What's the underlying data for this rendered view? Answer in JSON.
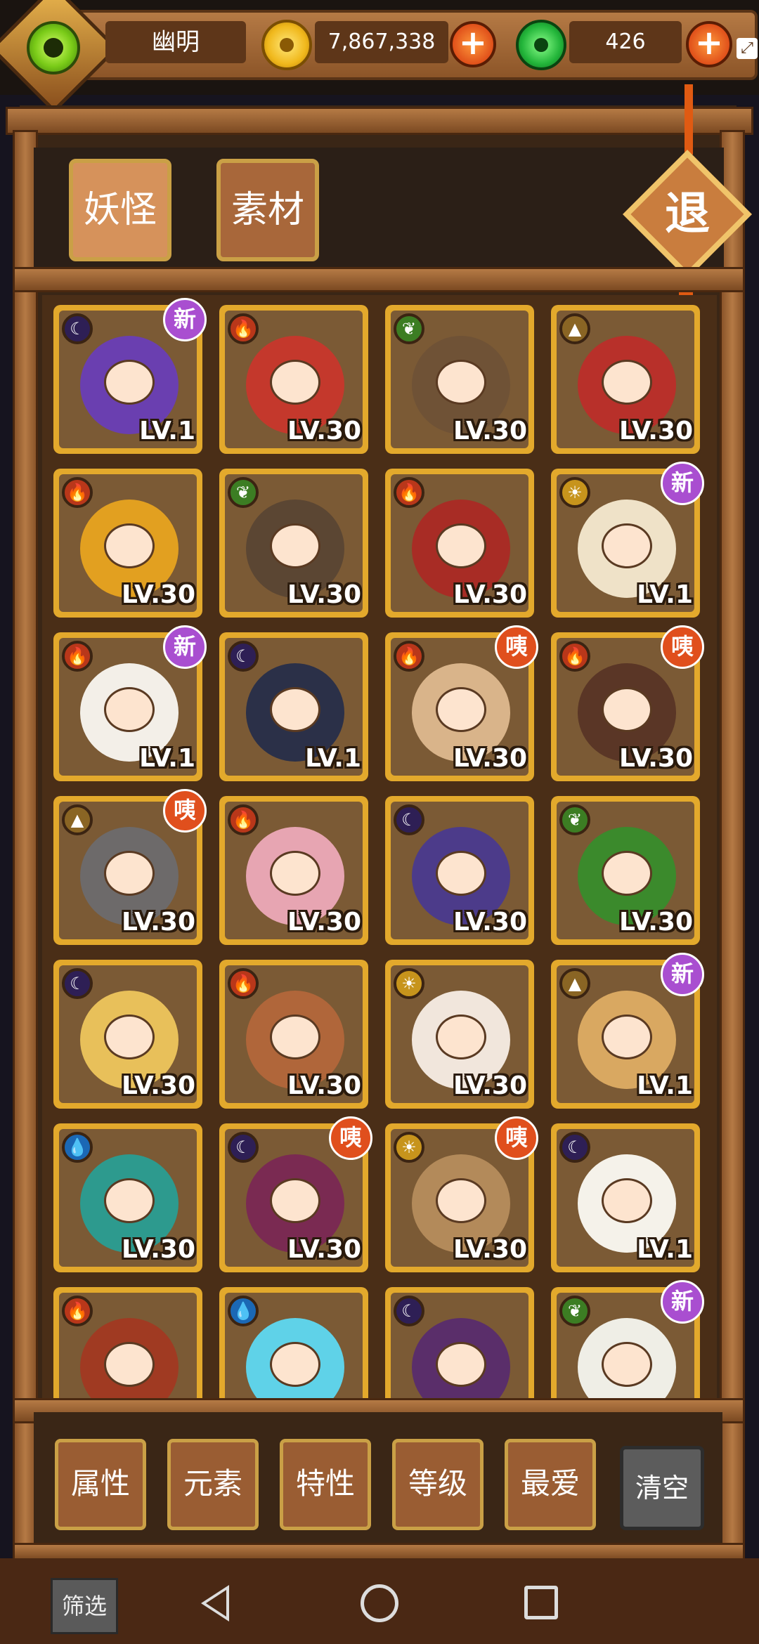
{
  "player": {
    "name": "幽明"
  },
  "currency": {
    "gold": "7,867,338",
    "jade": "426"
  },
  "tabs": [
    "妖怪",
    "素材"
  ],
  "exit_label": "退",
  "cards": [
    {
      "elem": "moon",
      "elem_icon": "☾",
      "level": "LV.1",
      "badge": "新",
      "badge_type": "new",
      "color": "#6a3fb0"
    },
    {
      "elem": "fire",
      "elem_icon": "🔥",
      "level": "LV.30",
      "badge": "",
      "badge_type": "",
      "color": "#c4382c"
    },
    {
      "elem": "leaf",
      "elem_icon": "❦",
      "level": "LV.30",
      "badge": "",
      "badge_type": "",
      "color": "#6f5236"
    },
    {
      "elem": "earth",
      "elem_icon": "▲",
      "level": "LV.30",
      "badge": "",
      "badge_type": "",
      "color": "#b8302a"
    },
    {
      "elem": "fire",
      "elem_icon": "🔥",
      "level": "LV.30",
      "badge": "",
      "badge_type": "",
      "color": "#e2a020"
    },
    {
      "elem": "leaf",
      "elem_icon": "❦",
      "level": "LV.30",
      "badge": "",
      "badge_type": "",
      "color": "#5b4633"
    },
    {
      "elem": "fire",
      "elem_icon": "🔥",
      "level": "LV.30",
      "badge": "",
      "badge_type": "",
      "color": "#a82c25"
    },
    {
      "elem": "sun",
      "elem_icon": "☀",
      "level": "LV.1",
      "badge": "新",
      "badge_type": "new",
      "color": "#efe2c8"
    },
    {
      "elem": "fire",
      "elem_icon": "🔥",
      "level": "LV.1",
      "badge": "新",
      "badge_type": "new",
      "color": "#f3efe8"
    },
    {
      "elem": "moon",
      "elem_icon": "☾",
      "level": "LV.1",
      "badge": "",
      "badge_type": "",
      "color": "#2b3048"
    },
    {
      "elem": "fire",
      "elem_icon": "🔥",
      "level": "LV.30",
      "badge": "咦",
      "badge_type": "rare",
      "color": "#d9b48a"
    },
    {
      "elem": "fire",
      "elem_icon": "🔥",
      "level": "LV.30",
      "badge": "咦",
      "badge_type": "rare",
      "color": "#5a3626"
    },
    {
      "elem": "earth",
      "elem_icon": "▲",
      "level": "LV.30",
      "badge": "咦",
      "badge_type": "rare",
      "color": "#6d6a6a"
    },
    {
      "elem": "fire",
      "elem_icon": "🔥",
      "level": "LV.30",
      "badge": "",
      "badge_type": "",
      "color": "#e7a5b2"
    },
    {
      "elem": "moon",
      "elem_icon": "☾",
      "level": "LV.30",
      "badge": "",
      "badge_type": "",
      "color": "#4c3b8a"
    },
    {
      "elem": "leaf",
      "elem_icon": "❦",
      "level": "LV.30",
      "badge": "",
      "badge_type": "",
      "color": "#3b8a2c"
    },
    {
      "elem": "moon",
      "elem_icon": "☾",
      "level": "LV.30",
      "badge": "",
      "badge_type": "",
      "color": "#e8c05a"
    },
    {
      "elem": "fire",
      "elem_icon": "🔥",
      "level": "LV.30",
      "badge": "",
      "badge_type": "",
      "color": "#b0663a"
    },
    {
      "elem": "sun",
      "elem_icon": "☀",
      "level": "LV.30",
      "badge": "",
      "badge_type": "",
      "color": "#f1e6dc"
    },
    {
      "elem": "earth",
      "elem_icon": "▲",
      "level": "LV.1",
      "badge": "新",
      "badge_type": "new",
      "color": "#d9a861"
    },
    {
      "elem": "water",
      "elem_icon": "💧",
      "level": "LV.30",
      "badge": "",
      "badge_type": "",
      "color": "#2d9a8e"
    },
    {
      "elem": "moon",
      "elem_icon": "☾",
      "level": "LV.30",
      "badge": "咦",
      "badge_type": "rare",
      "color": "#7a2a52"
    },
    {
      "elem": "sun",
      "elem_icon": "☀",
      "level": "LV.30",
      "badge": "咦",
      "badge_type": "rare",
      "color": "#b38a5a"
    },
    {
      "elem": "moon",
      "elem_icon": "☾",
      "level": "LV.1",
      "badge": "",
      "badge_type": "",
      "color": "#f5f2ea"
    },
    {
      "elem": "fire",
      "elem_icon": "🔥",
      "level": "",
      "badge": "",
      "badge_type": "",
      "color": "#a03a22"
    },
    {
      "elem": "water",
      "elem_icon": "💧",
      "level": "",
      "badge": "",
      "badge_type": "",
      "color": "#5fd2e8"
    },
    {
      "elem": "moon",
      "elem_icon": "☾",
      "level": "",
      "badge": "",
      "badge_type": "",
      "color": "#5a2e6a"
    },
    {
      "elem": "leaf",
      "elem_icon": "❦",
      "level": "",
      "badge": "新",
      "badge_type": "new",
      "color": "#efeee6"
    }
  ],
  "filters": [
    "属性",
    "元素",
    "特性",
    "等级",
    "最爱"
  ],
  "clear_label": "清空",
  "filter_nav_label": "筛选",
  "colors": {
    "frame_gold": "#e3a92c",
    "wood": "#b57a45",
    "new_badge": "#a94ed0",
    "rare_badge": "#e04f1d"
  }
}
